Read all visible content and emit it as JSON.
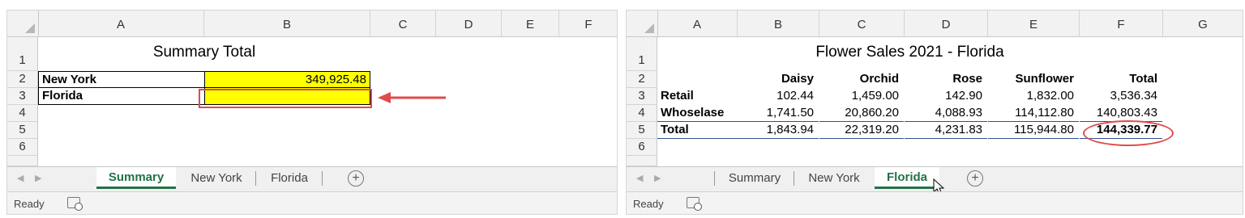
{
  "left": {
    "columns": [
      "A",
      "B",
      "C",
      "D",
      "E",
      "F"
    ],
    "rows": [
      "1",
      "2",
      "3",
      "4",
      "5",
      "6"
    ],
    "title": "Summary Total",
    "ny_label": "New York",
    "ny_value": "349,925.48",
    "fl_label": "Florida",
    "fl_value": "",
    "tabs": [
      "Summary",
      "New York",
      "Florida"
    ],
    "add_tab": "+",
    "status": "Ready",
    "highlight_color": "#ffff00",
    "callout_color": "#e04b4b"
  },
  "right": {
    "columns": [
      "A",
      "B",
      "C",
      "D",
      "E",
      "F",
      "G"
    ],
    "rows": [
      "1",
      "2",
      "3",
      "4",
      "5",
      "6"
    ],
    "title": "Flower Sales 2021 - Florida",
    "headers": [
      "Daisy",
      "Orchid",
      "Rose",
      "Sunflower",
      "Total"
    ],
    "table": [
      {
        "label": "Retail",
        "values": [
          "102.44",
          "1,459.00",
          "142.90",
          "1,832.00",
          "3,536.34"
        ]
      },
      {
        "label": "Whoselase",
        "values": [
          "1,741.50",
          "20,860.20",
          "4,088.93",
          "114,112.80",
          "140,803.43"
        ]
      },
      {
        "label": "Total",
        "values": [
          "1,843.94",
          "22,319.20",
          "4,231.83",
          "115,944.80",
          "144,339.77"
        ]
      }
    ],
    "tabs": [
      "Summary",
      "New York",
      "Florida"
    ],
    "add_tab": "+",
    "status": "Ready"
  }
}
